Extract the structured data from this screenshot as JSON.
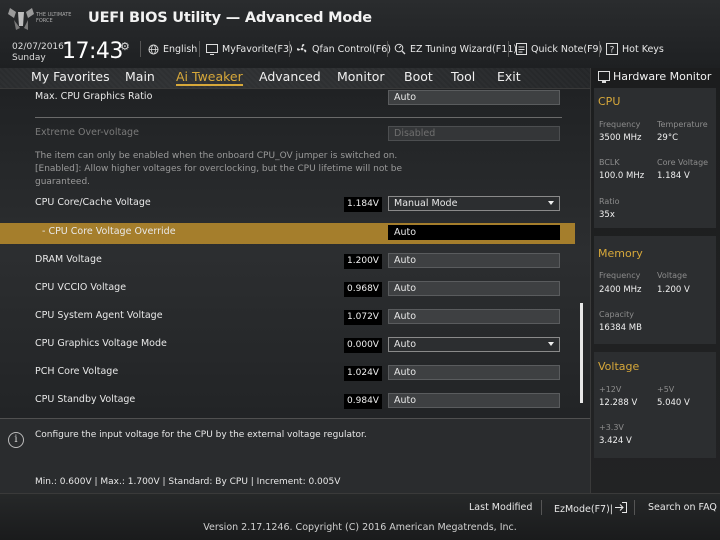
{
  "header": {
    "logo_text": "THE ULTIMATE FORCE",
    "title": "UEFI BIOS Utility — Advanced Mode",
    "date": "02/07/2016",
    "day": "Sunday",
    "time": "17:43",
    "toolbar": [
      {
        "icon": "globe-icon",
        "label": "English"
      },
      {
        "icon": "favorite-icon",
        "label": "MyFavorite(F3)"
      },
      {
        "icon": "fan-icon",
        "label": "Qfan Control(F6)"
      },
      {
        "icon": "ez-tuning-icon",
        "label": "EZ Tuning Wizard(F11)"
      },
      {
        "icon": "note-icon",
        "label": "Quick Note(F9)"
      },
      {
        "icon": "help-icon",
        "label": "Hot Keys"
      }
    ]
  },
  "menu": {
    "items": [
      "My Favorites",
      "Main",
      "Ai Tweaker",
      "Advanced",
      "Monitor",
      "Boot",
      "Tool",
      "Exit"
    ],
    "active": "Ai Tweaker"
  },
  "settings": {
    "max_cpu_graphics_ratio": {
      "label": "Max. CPU Graphics Ratio",
      "value": "Auto"
    },
    "extreme_overvoltage": {
      "label": "Extreme Over-voltage",
      "value": "Disabled"
    },
    "note_lines": [
      "The item can only be enabled when the onboard CPU_OV jumper is switched on.",
      "[Enabled]: Allow higher voltages for overclocking, but the CPU lifetime will not be",
      "guaranteed."
    ],
    "cpu_core_cache_voltage": {
      "label": "CPU Core/Cache Voltage",
      "reading": "1.184V",
      "value": "Manual Mode"
    },
    "cpu_core_voltage_override": {
      "label": "- CPU Core Voltage Override",
      "value": "Auto"
    },
    "dram_voltage": {
      "label": "DRAM Voltage",
      "reading": "1.200V",
      "value": "Auto"
    },
    "cpu_vccio_voltage": {
      "label": "CPU VCCIO Voltage",
      "reading": "0.968V",
      "value": "Auto"
    },
    "cpu_system_agent_voltage": {
      "label": "CPU System Agent Voltage",
      "reading": "1.072V",
      "value": "Auto"
    },
    "cpu_graphics_voltage_mode": {
      "label": "CPU Graphics Voltage Mode",
      "reading": "0.000V",
      "value": "Auto"
    },
    "pch_core_voltage": {
      "label": "PCH Core Voltage",
      "reading": "1.024V",
      "value": "Auto"
    },
    "cpu_standby_voltage": {
      "label": "CPU Standby Voltage",
      "reading": "0.984V",
      "value": "Auto"
    }
  },
  "info": {
    "help": "Configure the input voltage for the CPU by the external voltage regulator.",
    "range": "Min.: 0.600V   |   Max.: 1.700V   |   Standard: By CPU   |   Increment: 0.005V"
  },
  "hardware_monitor": {
    "title": "Hardware Monitor",
    "cpu": {
      "title": "CPU",
      "frequency_label": "Frequency",
      "frequency": "3500 MHz",
      "temperature_label": "Temperature",
      "temperature": "29°C",
      "bclk_label": "BCLK",
      "bclk": "100.0 MHz",
      "core_voltage_label": "Core Voltage",
      "core_voltage": "1.184 V",
      "ratio_label": "Ratio",
      "ratio": "35x"
    },
    "memory": {
      "title": "Memory",
      "frequency_label": "Frequency",
      "frequency": "2400 MHz",
      "voltage_label": "Voltage",
      "voltage": "1.200 V",
      "capacity_label": "Capacity",
      "capacity": "16384 MB"
    },
    "voltage": {
      "title": "Voltage",
      "v12_label": "+12V",
      "v12": "12.288 V",
      "v5_label": "+5V",
      "v5": "5.040 V",
      "v33_label": "+3.3V",
      "v33": "3.424 V"
    }
  },
  "bottom": {
    "last_modified": "Last Modified",
    "ezmode": "EzMode(F7)|",
    "search": "Search on FAQ",
    "copyright": "Version 2.17.1246. Copyright (C) 2016 American Megatrends, Inc."
  },
  "colors": {
    "accent": "#d7a83a",
    "selection": "#a57e2c"
  }
}
